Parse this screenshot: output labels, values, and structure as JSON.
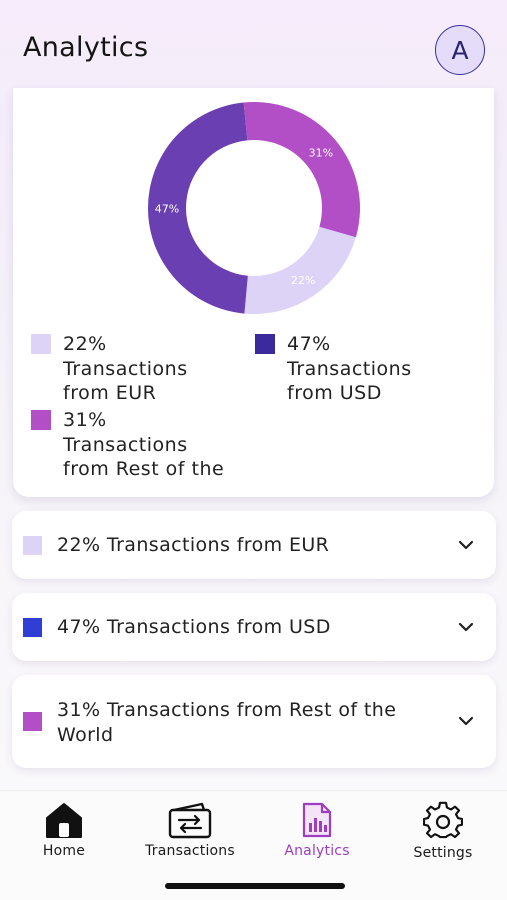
{
  "header": {
    "title": "Analytics",
    "avatar_initial": "A"
  },
  "colors": {
    "eur": "#dcd3f7",
    "usd_chart": "#6a3fb1",
    "usd_legend": "#3b2a9e",
    "usd_list": "#2f3fd6",
    "rest": "#b24ec6",
    "active_nav": "#9b3fc0"
  },
  "chart_data": {
    "type": "pie",
    "donut": true,
    "series": [
      {
        "name": "Transactions from EUR",
        "value": 22,
        "label": "22%"
      },
      {
        "name": "Transactions from USD",
        "value": 47,
        "label": "47%"
      },
      {
        "name": "Transactions from Rest of the World",
        "value": 31,
        "label": "31%"
      }
    ],
    "legend": [
      {
        "line1": "22%",
        "line2": "Transactions",
        "line3": "from EUR"
      },
      {
        "line1": "47%",
        "line2": "Transactions",
        "line3": "from USD"
      },
      {
        "line1": "31%",
        "line2": "Transactions",
        "line3": "from Rest of the"
      }
    ]
  },
  "breakdown": [
    {
      "label": "22% Transactions from EUR",
      "chevron_icon": "chevron-down-icon"
    },
    {
      "label": "47% Transactions from USD",
      "chevron_icon": "chevron-down-icon"
    },
    {
      "label_line1": "31% Transactions from Rest of the",
      "label_line2": "World",
      "chevron_icon": "chevron-down-icon"
    }
  ],
  "nav": [
    {
      "label": "Home",
      "icon": "home-icon"
    },
    {
      "label": "Transactions",
      "icon": "wallet-transfer-icon"
    },
    {
      "label": "Analytics",
      "icon": "analytics-report-icon",
      "active": true
    },
    {
      "label": "Settings",
      "icon": "gear-icon"
    }
  ]
}
